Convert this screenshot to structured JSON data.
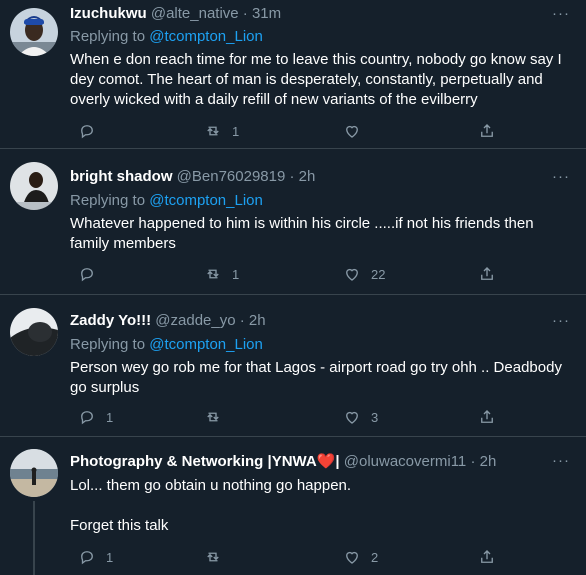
{
  "replying_to_label": "Replying to",
  "tweets": [
    {
      "name": "Izuchukwu",
      "handle": "@alte_native",
      "separator": "·",
      "time": "31m",
      "mention": "@tcompton_Lion",
      "body": "When e don reach time for me to leave this country, nobody go know say I dey comot. The heart of man is desperately, constantly, perpetually and overly wicked with a daily refill of new variants of the evilberry",
      "replies": "",
      "retweets": "1",
      "likes": ""
    },
    {
      "name": "bright shadow",
      "handle": "@Ben76029819",
      "separator": "·",
      "time": "2h",
      "mention": "@tcompton_Lion",
      "body": "Whatever happened to him is within his circle .....if not his friends then family members",
      "replies": "",
      "retweets": "1",
      "likes": "22"
    },
    {
      "name": "Zaddy Yo!!!",
      "handle": "@zadde_yo",
      "separator": "·",
      "time": "2h",
      "mention": "@tcompton_Lion",
      "body": "Person wey go rob me for that Lagos - airport road go try ohh .. Deadbody go surplus",
      "replies": "1",
      "retweets": "",
      "likes": "3"
    },
    {
      "name": "Photography & Networking |YNWA",
      "name_suffix": "|",
      "heart_emoji": "❤️",
      "handle": "@oluwacovermi11",
      "separator": "·",
      "time": "2h",
      "body_line1": "Lol... them go obtain u nothing go happen.",
      "body_line2": "Forget this talk",
      "replies": "1",
      "retweets": "",
      "likes": "2"
    }
  ],
  "more_icon": "···",
  "colors": {
    "background": "#15202b",
    "secondary_text": "#8899a6",
    "link": "#1da1f2",
    "divider": "#38444d",
    "heart_red": "#e0245e"
  }
}
